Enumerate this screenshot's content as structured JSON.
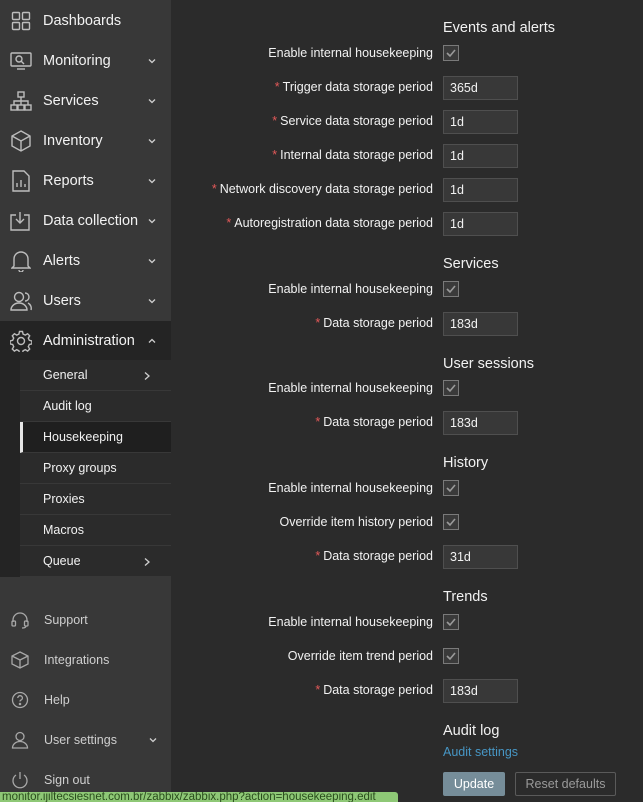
{
  "sidebar": {
    "nav": [
      {
        "label": "Dashboards",
        "icon": "dashboards-icon"
      },
      {
        "label": "Monitoring",
        "icon": "monitoring-icon"
      },
      {
        "label": "Services",
        "icon": "services-icon"
      },
      {
        "label": "Inventory",
        "icon": "inventory-icon"
      },
      {
        "label": "Reports",
        "icon": "reports-icon"
      },
      {
        "label": "Data collection",
        "icon": "data-collection-icon"
      },
      {
        "label": "Alerts",
        "icon": "alerts-icon"
      },
      {
        "label": "Users",
        "icon": "users-icon"
      },
      {
        "label": "Administration",
        "icon": "administration-icon"
      }
    ],
    "submenu": [
      {
        "label": "General"
      },
      {
        "label": "Audit log"
      },
      {
        "label": "Housekeeping"
      },
      {
        "label": "Proxy groups"
      },
      {
        "label": "Proxies"
      },
      {
        "label": "Macros"
      },
      {
        "label": "Queue"
      }
    ],
    "footer": [
      {
        "label": "Support",
        "icon": "support-icon"
      },
      {
        "label": "Integrations",
        "icon": "integrations-icon"
      },
      {
        "label": "Help",
        "icon": "help-icon"
      },
      {
        "label": "User settings",
        "icon": "user-settings-icon"
      },
      {
        "label": "Sign out",
        "icon": "sign-out-icon"
      }
    ]
  },
  "status_url": "monitor.ijiltecsiesnet.com.br/zabbix/zabbix.php?action=housekeeping.edit",
  "form": {
    "events": {
      "title": "Events and alerts",
      "enable_label": "Enable internal housekeeping",
      "enabled": true,
      "trigger_label": "Trigger data storage period",
      "trigger_value": "365d",
      "service_label": "Service data storage period",
      "service_value": "1d",
      "internal_label": "Internal data storage period",
      "internal_value": "1d",
      "discovery_label": "Network discovery data storage period",
      "discovery_value": "1d",
      "autoreg_label": "Autoregistration data storage period",
      "autoreg_value": "1d"
    },
    "services": {
      "title": "Services",
      "enable_label": "Enable internal housekeeping",
      "enabled": true,
      "period_label": "Data storage period",
      "period_value": "183d"
    },
    "sessions": {
      "title": "User sessions",
      "enable_label": "Enable internal housekeeping",
      "enabled": true,
      "period_label": "Data storage period",
      "period_value": "183d"
    },
    "history": {
      "title": "History",
      "enable_label": "Enable internal housekeeping",
      "enabled": true,
      "override_label": "Override item history period",
      "override": true,
      "period_label": "Data storage period",
      "period_value": "31d"
    },
    "trends": {
      "title": "Trends",
      "enable_label": "Enable internal housekeeping",
      "enabled": true,
      "override_label": "Override item trend period",
      "override": true,
      "period_label": "Data storage period",
      "period_value": "183d"
    },
    "audit": {
      "title": "Audit log",
      "link": "Audit settings"
    },
    "update_label": "Update",
    "reset_label": "Reset defaults"
  }
}
